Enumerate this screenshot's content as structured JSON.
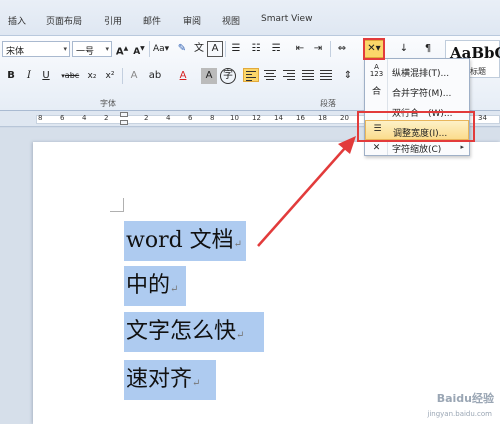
{
  "tabs": [
    "插入",
    "页面布局",
    "引用",
    "邮件",
    "审阅",
    "视图",
    "Smart View"
  ],
  "font": {
    "name": "宋体",
    "size": "一号"
  },
  "groups": {
    "font_label": "字体",
    "paragraph_label": "段落"
  },
  "styles": {
    "sample": "AaBbC",
    "label": "标题"
  },
  "ruler_numbers": [
    "8",
    "6",
    "4",
    "2",
    "2",
    "4",
    "6",
    "8",
    "10",
    "12",
    "14",
    "16",
    "18",
    "20",
    "22",
    "24",
    "26",
    "34"
  ],
  "document": {
    "lines": [
      "word 文档",
      "中的",
      "文字怎么快",
      "速对齐"
    ]
  },
  "dropdown": {
    "items": [
      {
        "label": "纵横混排(T)...",
        "icon": "A/123"
      },
      {
        "label": "合并字符(M)...",
        "icon": "合"
      },
      {
        "label": "双行合一(W)...",
        "icon": ""
      },
      {
        "label": "调整宽度(I)...",
        "icon": "width"
      },
      {
        "label": "字符缩放(C)",
        "icon": "X"
      }
    ]
  },
  "watermark": {
    "brand": "Baidu经验",
    "url": "jingyan.baidu.com"
  },
  "colors": {
    "highlight": "#aecbf0",
    "callout": "#e23b3b",
    "active": "#fbd669"
  }
}
